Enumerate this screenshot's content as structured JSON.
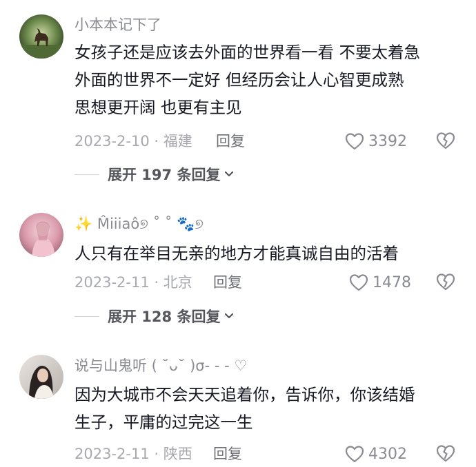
{
  "colors": {
    "text_primary": "#161823",
    "text_secondary": "#8a8b91",
    "text_meta": "#a8a9ae",
    "expand_text": "#55565c"
  },
  "comments": [
    {
      "username": "小本本记下了",
      "avatar_icon": "deer-in-forest-avatar",
      "lines": [
        "女孩子还是应该去外面的世界看一看 不要太着急",
        "外面的世界不一定好 但经历会让人心智更成熟",
        "思想更开阔 也更有主见"
      ],
      "date_location": "2023-2-10 · 福建",
      "reply_label": "回复",
      "likes": "3392",
      "expand_label": "展开 197 条回复"
    },
    {
      "username": "✨ M̂iiiaô୭ ˚ ˚ 🐾୭",
      "avatar_icon": "pink-portrait-avatar",
      "lines": [
        "人只有在举目无亲的地方才能真诚自由的活着"
      ],
      "date_location": "2023-2-11 · 北京",
      "reply_label": "回复",
      "likes": "1478",
      "expand_label": "展开 128 条回复"
    },
    {
      "username": "说与山鬼听 ( ˘ᴗ˘ )σ- - - ♡",
      "avatar_icon": "girl-portrait-avatar",
      "lines": [
        "因为大城市不会天天追着你，告诉你，你该结婚",
        "生子，平庸的过完这一生"
      ],
      "date_location": "2023-2-11 · 陕西",
      "reply_label": "回复",
      "likes": "4302"
    }
  ]
}
